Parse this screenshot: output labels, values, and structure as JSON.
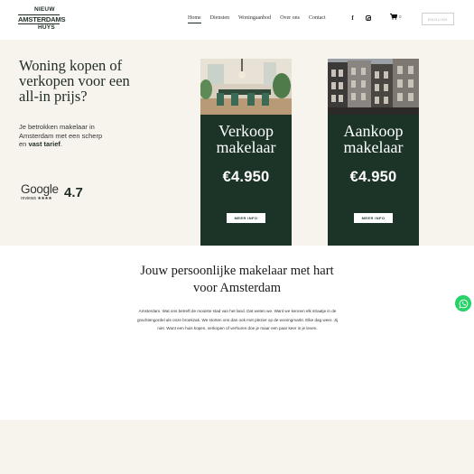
{
  "brand": {
    "logo_line1": "NIEUW",
    "logo_line2": "AMSTERDAMS",
    "logo_line3": "HUYS",
    "color_primary": "#1c3427",
    "color_background": "#f7f4ee"
  },
  "nav": {
    "items": [
      "Home",
      "Diensten",
      "Woningaanbod",
      "Over ons",
      "Contact"
    ],
    "active": "Home"
  },
  "social": {
    "icons": [
      "facebook-icon",
      "instagram-icon"
    ]
  },
  "cart": {
    "count": "0",
    "icon": "cart-icon"
  },
  "lang_button": {
    "label": "ENGLISH"
  },
  "hero": {
    "title": "Woning kopen of verkopen voor een all-in prijs?",
    "subtitle_part1": "Je betrokken makelaar in Amsterdam met een scherp en ",
    "subtitle_bold": "vast tarief",
    "subtitle_part2": ".",
    "google_word": "Google",
    "google_reviews": "reviews",
    "google_stars": "★★★★",
    "rating": "4.7"
  },
  "cards": [
    {
      "title_line1": "Verkoop",
      "title_line2": "makelaar",
      "price": "€4.950",
      "button": "MEER INFO"
    },
    {
      "title_line1": "Aankoop",
      "title_line2": "makelaar",
      "price": "€4.950",
      "button": "MEER INFO"
    }
  ],
  "intro": {
    "title_line1": "Jouw persoonlijke makelaar met hart",
    "title_line2": "voor Amsterdam",
    "body": "Amsterdam. Wat ons betreft de mooiste stad van het land. Dat weten we. Want we kennen elk straatje in de grachtengordel als onze broekzak. We storten ons dan ook met plezier op de woningmarkt. Elke dag weer. Jij niet. Want een huis kopen, verkopen of verhuren doe je maar een paar keer in je leven."
  },
  "whatsapp": {
    "icon": "whatsapp-icon",
    "color": "#25d366"
  }
}
